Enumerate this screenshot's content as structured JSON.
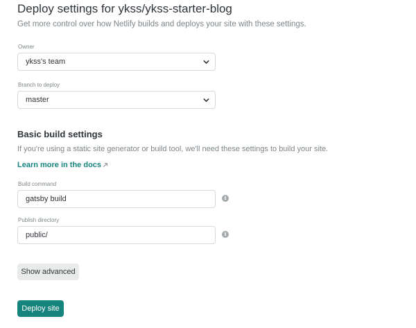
{
  "header": {
    "title": "Deploy settings for ykss/ykss-starter-blog",
    "subtitle": "Get more control over how Netlify builds and deploys your site with these settings."
  },
  "owner": {
    "label": "Owner",
    "value": "ykss's team"
  },
  "branch": {
    "label": "Branch to deploy",
    "value": "master"
  },
  "basic_build": {
    "title": "Basic build settings",
    "description": "If you're using a static site generator or build tool, we'll need these settings to build your site.",
    "docs_link": "Learn more in the docs",
    "build_command": {
      "label": "Build command",
      "value": "gatsby build"
    },
    "publish_directory": {
      "label": "Publish directory",
      "value": "public/"
    },
    "info_glyph": "i"
  },
  "buttons": {
    "show_advanced": "Show advanced",
    "deploy_site": "Deploy site"
  },
  "colors": {
    "accent": "#15847d",
    "text": "#2e3338",
    "muted": "#7d8589",
    "border": "#d7d9da",
    "button_secondary": "#e9ebeb",
    "info_icon": "#a3a9ac"
  },
  "icons": {
    "dropdown": "chevron-down-icon",
    "external_link": "external-link-icon",
    "info": "info-icon"
  }
}
